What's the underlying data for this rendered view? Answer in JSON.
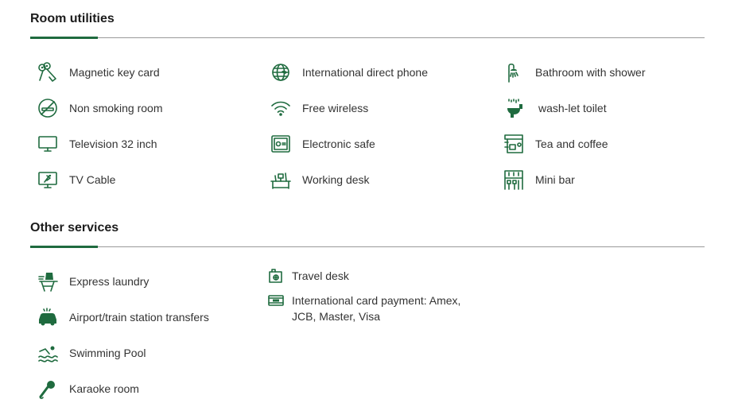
{
  "sections": {
    "room": {
      "title": "Room utilities",
      "items": [
        {
          "label": "Magnetic key card",
          "icon": "key-card-icon"
        },
        {
          "label": "International direct phone",
          "icon": "globe-phone-icon"
        },
        {
          "label": "Bathroom with shower",
          "icon": "shower-icon"
        },
        {
          "label": "Non smoking room",
          "icon": "no-smoking-icon"
        },
        {
          "label": "Free wireless",
          "icon": "wifi-icon"
        },
        {
          "label": "wash-let toilet",
          "icon": "toilet-icon"
        },
        {
          "label": "Television 32 inch",
          "icon": "tv-icon"
        },
        {
          "label": "Electronic safe",
          "icon": "safe-icon"
        },
        {
          "label": "Tea and coffee",
          "icon": "coffee-machine-icon"
        },
        {
          "label": "TV Cable",
          "icon": "tv-cable-icon"
        },
        {
          "label": "Working desk",
          "icon": "desk-icon"
        },
        {
          "label": "Mini bar",
          "icon": "mini-bar-icon"
        }
      ]
    },
    "other": {
      "title": "Other services",
      "items": [
        {
          "label": "Express laundry",
          "icon": "laundry-icon"
        },
        {
          "label": "Airport/train station transfers",
          "icon": "car-icon"
        },
        {
          "label": "Swimming Pool",
          "icon": "swimmer-icon"
        },
        {
          "label": "Karaoke room",
          "icon": "microphone-icon"
        },
        {
          "label": "Travel desk",
          "icon": "travel-desk-icon"
        },
        {
          "label": "International card payment: Amex, JCB, Master, Visa",
          "label_line1": "International card payment: Amex,",
          "label_line2": "JCB, Master, Visa",
          "icon": "credit-card-icon"
        }
      ]
    }
  },
  "colors": {
    "accent": "#1f6b3f",
    "text": "#333333",
    "rule": "#9a9a9a"
  }
}
